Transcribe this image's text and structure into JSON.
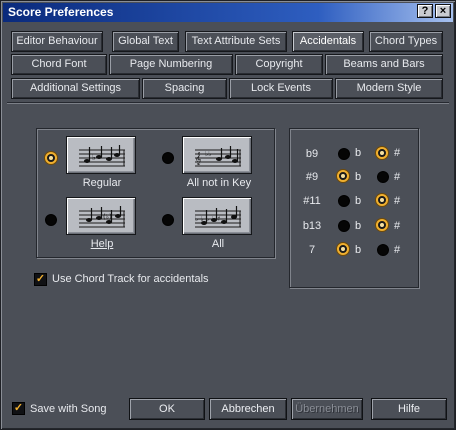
{
  "window": {
    "title": "Score Preferences",
    "help_button": "?",
    "close_button": "×"
  },
  "tabs": {
    "row1": [
      "Editor Behaviour",
      "Global Text",
      "Text Attribute Sets",
      "Accidentals",
      "Chord Types"
    ],
    "row2": [
      "Chord Font",
      "Page Numbering",
      "Copyright",
      "Beams and Bars"
    ],
    "row3": [
      "Additional Settings",
      "Spacing",
      "Lock Events",
      "Modern Style"
    ],
    "active": "Accidentals"
  },
  "accidental_modes": {
    "options": [
      {
        "label": "Regular",
        "selected": true
      },
      {
        "label": "All not in Key",
        "selected": false
      },
      {
        "label": "Help",
        "selected": false
      },
      {
        "label": "All",
        "selected": false
      }
    ]
  },
  "chord_track_checkbox": {
    "label": "Use Chord Track for accidentals",
    "checked": true,
    "mark": "✓"
  },
  "alterations": {
    "flat_label": "b",
    "sharp_label": "#",
    "rows": [
      {
        "label": "b9",
        "selected": "sharp"
      },
      {
        "label": "#9",
        "selected": "flat"
      },
      {
        "label": "#11",
        "selected": "sharp"
      },
      {
        "label": "b13",
        "selected": "sharp"
      },
      {
        "label": "7",
        "selected": "flat"
      }
    ]
  },
  "footer": {
    "save_with_song": {
      "label": "Save with Song",
      "checked": true,
      "mark": "✓"
    },
    "ok": "OK",
    "cancel": "Abbrechen",
    "apply": "Übernehmen",
    "help": "Hilfe"
  },
  "colors": {
    "window_bg": "#4b4f57",
    "title_gradient_start": "#0a2a7c",
    "radio_selected_ring": "#f0b030"
  }
}
